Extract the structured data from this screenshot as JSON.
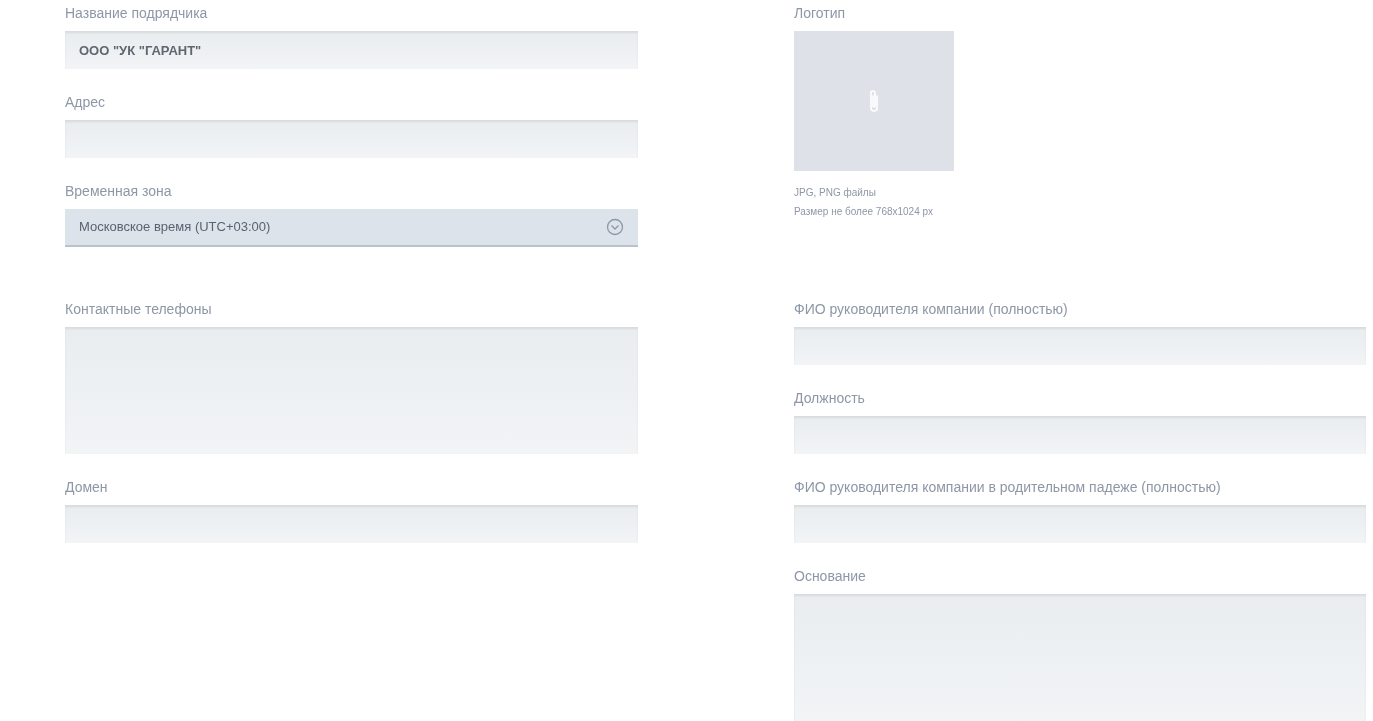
{
  "sections": [
    {
      "left": [
        {
          "kind": "text",
          "label": "Название подрядчика",
          "value": "ООО \"УК \"ГАРАНТ\""
        },
        {
          "kind": "text",
          "label": "Адрес"
        },
        {
          "kind": "select",
          "label": "Временная зона",
          "value": "Московское время (UTC+03:00)"
        }
      ],
      "right": [
        {
          "kind": "upload",
          "label": "Логотип",
          "hints": [
            "JPG, PNG файлы",
            "Размер не более 768x1024 px"
          ]
        }
      ]
    },
    {
      "left": [
        {
          "kind": "textarea",
          "label": "Контактные телефоны"
        },
        {
          "kind": "text",
          "label": "Домен"
        }
      ],
      "right": [
        {
          "kind": "text",
          "label": "ФИО руководителя компании (полностью)"
        },
        {
          "kind": "text",
          "label": "Должность"
        },
        {
          "kind": "text",
          "label": "ФИО руководителя компании в родительном падеже (полностью)"
        },
        {
          "kind": "textarea",
          "label": "Основание"
        }
      ]
    }
  ]
}
